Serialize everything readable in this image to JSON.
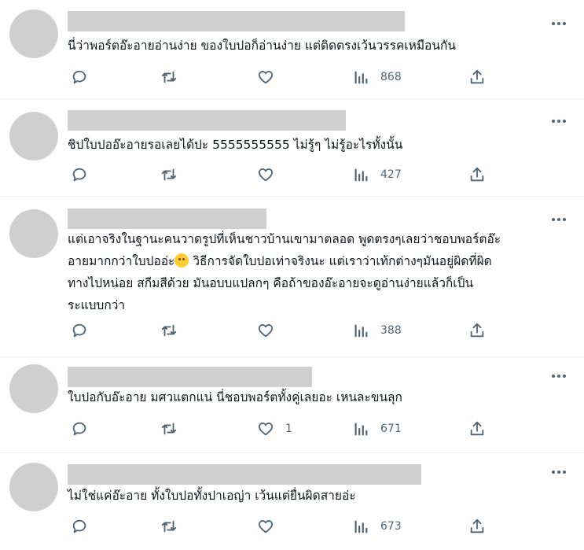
{
  "tweets": [
    {
      "text": "นี่ว่าพอร์ตอ๊ะอายอ่านง่าย ของใบปอก็อ่านง่าย แต่ติดตรงเว้นวรรคเหมือนกัน",
      "likes": "",
      "views": "868"
    },
    {
      "text": "ชิปใบปออ๊ะอายรอเลยได้ปะ 5555555555 ไม่รู้ๆ ไม่รู้อะไรทั้งนั้น",
      "likes": "",
      "views": "427"
    },
    {
      "text_lines": [
        "แต่เอาจริงในฐานะคนวาดรูปที่เห็นชาวบ้านเขามาตลอด พูดตรงๆเลยว่าชอบพอร์ตอ๊ะ",
        "อายมากกว่าใบปออ่ะ",
        " วิธีการจัดใบปอเท่าจริงนะ แต่เราว่าเท้กต่างๆมันอยู่ผิดที่ผิด",
        "ทางไปหน่อย สกีมสีด้วย มันอบบแปลกๆ คือถ้าของอ๊ะอายจะดูอ่านง่ายแล้วก็เป็น",
        "ระแบบกว่า"
      ],
      "likes": "",
      "views": "388"
    },
    {
      "text": "ใบปอกับอ๊ะอาย มศวแตกแน่ นี่ชอบพอร์ตทั้งคู่เลยอะ เหนละขนลุก",
      "likes": "1",
      "views": "671"
    },
    {
      "text": "ไม่ใช่แค่อ๊ะอาย ทั้งใบปอทั้งปาเอญ่า เว้นแต่ยื่นผิดสายอ่ะ",
      "likes": "",
      "views": "673"
    }
  ],
  "icons": {
    "reply": "reply-icon",
    "retweet": "retweet-icon",
    "like": "heart-icon",
    "views": "views-icon",
    "share": "share-icon",
    "more": "more-icon",
    "emoji": "emoji-icon"
  },
  "colors": {
    "icon": "#536471",
    "text": "#0f1419",
    "placeholder": "#cfcfcf",
    "emoji": "#ffcc33"
  }
}
